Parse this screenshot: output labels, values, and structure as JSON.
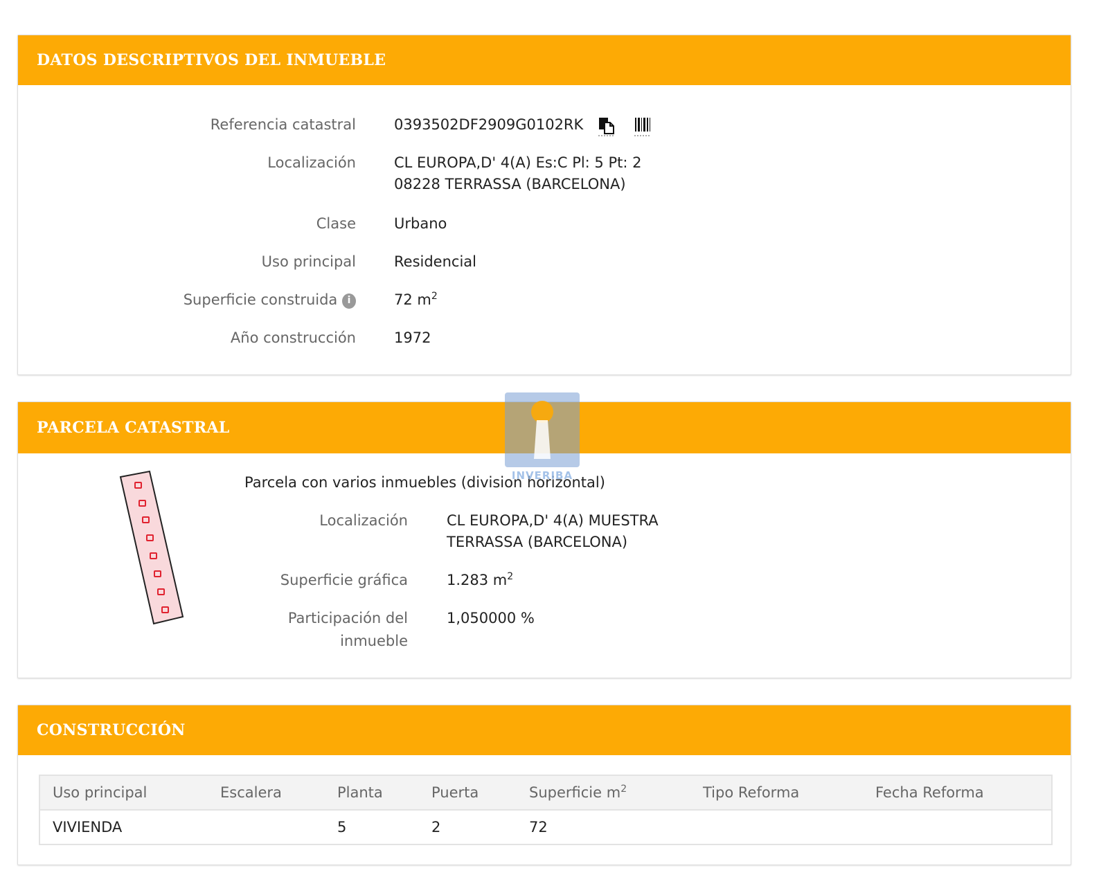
{
  "datos": {
    "header": "DATOS DESCRIPTIVOS DEL INMUEBLE",
    "ref_label": "Referencia catastral",
    "ref_value": "0393502DF2909G0102RK",
    "loc_label": "Localización",
    "loc_line1": "CL EUROPA,D' 4(A) Es:C Pl: 5 Pt: 2",
    "loc_line2": "08228 TERRASSA (BARCELONA)",
    "clase_label": "Clase",
    "clase_value": "Urbano",
    "uso_label": "Uso principal",
    "uso_value": "Residencial",
    "sup_label": "Superficie construida",
    "sup_value": "72 m",
    "sup_unit_exp": "2",
    "anio_label": "Año construcción",
    "anio_value": "1972"
  },
  "parcela": {
    "header": "PARCELA CATASTRAL",
    "title": "Parcela con varios inmuebles (division horizontal)",
    "loc_label": "Localización",
    "loc_line1": "CL EUROPA,D' 4(A) MUESTRA",
    "loc_line2": "TERRASSA (BARCELONA)",
    "sup_label": "Superficie gráfica",
    "sup_value": "1.283 m",
    "sup_unit_exp": "2",
    "part_label_1": "Participación del",
    "part_label_2": "inmueble",
    "part_value": "1,050000 %"
  },
  "construccion": {
    "header": "CONSTRUCCIÓN",
    "columns": [
      "Uso principal",
      "Escalera",
      "Planta",
      "Puerta",
      "Superficie m",
      "Tipo Reforma",
      "Fecha Reforma"
    ],
    "sup_col_exp": "2",
    "rows": [
      [
        "VIVIENDA",
        "",
        "5",
        "2",
        "72",
        "",
        ""
      ]
    ]
  },
  "watermark": {
    "text": "INVERIBA",
    "color": "#8eb4e3"
  },
  "colors": {
    "header": "#fdaa05",
    "parcel_fill": "#f9d9dc",
    "parcel_mark": "#e0222f"
  },
  "icons": [
    "copy-icon",
    "barcode-icon",
    "info-icon"
  ]
}
